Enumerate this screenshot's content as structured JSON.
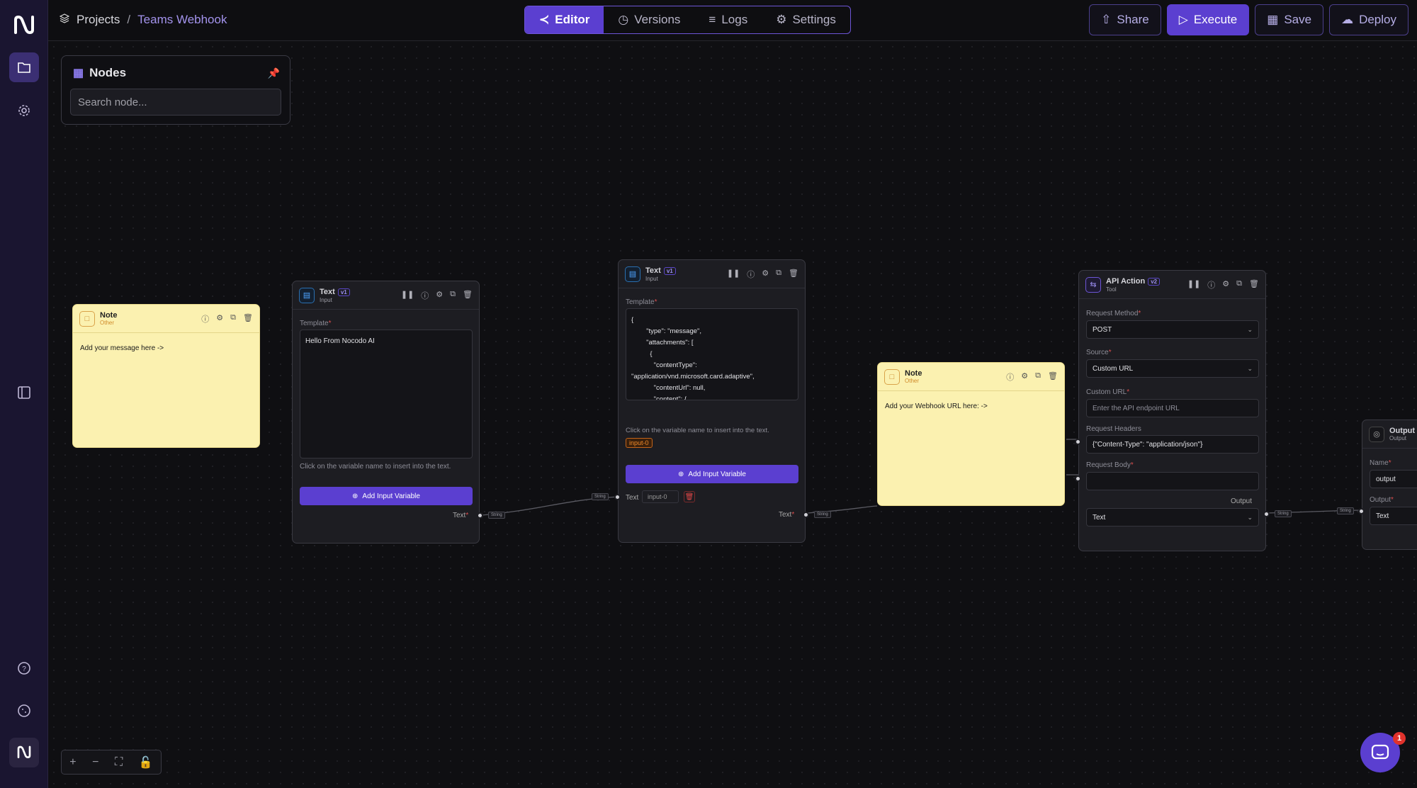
{
  "breadcrumb": {
    "root": "Projects",
    "separator": "/",
    "current": "Teams Webhook"
  },
  "tabs": [
    {
      "label": "Editor",
      "icon": "share-nodes-icon",
      "active": true
    },
    {
      "label": "Versions",
      "icon": "history-icon"
    },
    {
      "label": "Logs",
      "icon": "list-icon"
    },
    {
      "label": "Settings",
      "icon": "gear-icon"
    }
  ],
  "actions": {
    "share": "Share",
    "execute": "Execute",
    "save": "Save",
    "deploy": "Deploy"
  },
  "nodes_panel": {
    "title": "Nodes",
    "search_placeholder": "Search node..."
  },
  "note1": {
    "title": "Note",
    "subtitle": "Other",
    "body": "Add your message here ->"
  },
  "text1": {
    "title": "Text",
    "subtitle": "Input",
    "version": "v1",
    "template_label": "Template",
    "template": "Hello From Nocodo AI",
    "hint": "Click on the variable name to insert into the text.",
    "add_button": "Add Input Variable",
    "output_label": "Text",
    "output_type": "String"
  },
  "text2": {
    "title": "Text",
    "subtitle": "Input",
    "version": "v1",
    "template_label": "Template",
    "template": "{\n        \"type\": \"message\",\n        \"attachments\": [\n          {\n            \"contentType\":\n\"application/vnd.microsoft.card.adaptive\",\n            \"contentUrl\": null,\n            \"content\": {\n              \"$schema\":\n\"http://adaptivecards.io/schemas/adaptive-",
    "hint": "Click on the variable name to insert into the text.",
    "variable_chip": "input-0",
    "add_button": "Add Input Variable",
    "input_label": "Text",
    "input_value": "input-0",
    "input_type": "String",
    "output_label": "Text",
    "output_type": "String"
  },
  "note2": {
    "title": "Note",
    "subtitle": "Other",
    "body": "Add your Webhook URL here: ->"
  },
  "api": {
    "title": "API Action",
    "subtitle": "Tool",
    "version": "v2",
    "method_label": "Request Method",
    "method": "POST",
    "source_label": "Source",
    "source": "Custom URL",
    "url_label": "Custom URL",
    "url_placeholder": "Enter the API endpoint URL",
    "headers_label": "Request Headers",
    "headers": "{\"Content-Type\": \"application/json\"}",
    "body_label": "Request Body",
    "output_label": "Output",
    "output": "Text",
    "output_type": "String"
  },
  "output": {
    "title": "Output",
    "subtitle": "Output",
    "name_label": "Name",
    "name": "output",
    "output_label": "Output",
    "output": "Text",
    "input_type": "String"
  },
  "chat_badge": "1"
}
